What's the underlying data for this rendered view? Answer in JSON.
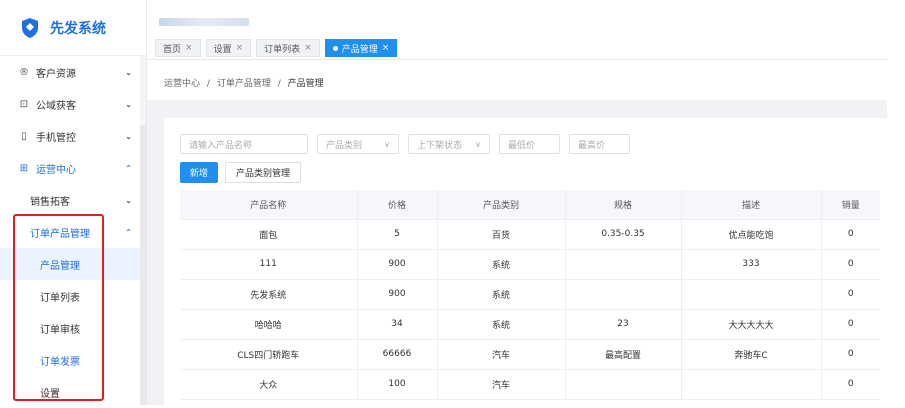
{
  "app": {
    "title": "先发系统"
  },
  "sidebar": {
    "items": [
      {
        "icon": "®",
        "label": "客户资源",
        "chev": "⌄"
      },
      {
        "icon": "⊡",
        "label": "公域获客",
        "chev": "⌄"
      },
      {
        "icon": "▯",
        "label": "手机管控",
        "chev": "⌄"
      },
      {
        "icon": "⊞",
        "label": "运营中心",
        "chev": "⌃"
      },
      {
        "label": "销售拓客",
        "chev": "⌄"
      },
      {
        "label": "订单产品管理",
        "chev": "⌃"
      },
      {
        "label": "产品管理"
      },
      {
        "label": "订单列表"
      },
      {
        "label": "订单审核"
      },
      {
        "label": "订单发票"
      },
      {
        "label": "设置"
      }
    ]
  },
  "tabs": [
    {
      "label": "首页"
    },
    {
      "label": "设置"
    },
    {
      "label": "订单列表"
    },
    {
      "label": "产品管理"
    }
  ],
  "tab_close": "×",
  "breadcrumb": {
    "a": "运营中心",
    "sep": "/",
    "b": "订单产品管理",
    "c": "产品管理"
  },
  "filters": {
    "name_placeholder": "请输入产品名称",
    "category": "产品类别",
    "status": "上下架状态",
    "min_price": "最低价",
    "max_price": "最高价",
    "arrow": "∨"
  },
  "buttons": {
    "add": "新增",
    "category_manage": "产品类别管理"
  },
  "table": {
    "headers": [
      "产品名称",
      "价格",
      "产品类别",
      "规格",
      "描述",
      "销量"
    ],
    "rows": [
      [
        "面包",
        "5",
        "百货",
        "0.35-0.35",
        "优点能吃饱",
        "0"
      ],
      [
        "111",
        "900",
        "系统",
        "",
        "333",
        "0"
      ],
      [
        "先发系统",
        "900",
        "系统",
        "",
        "",
        "0"
      ],
      [
        "哈哈哈",
        "34",
        "系统",
        "23",
        "大大大大大",
        "0"
      ],
      [
        "CLS四门轿跑车",
        "66666",
        "汽车",
        "最高配置",
        "奔驰车C",
        "0"
      ],
      [
        "大众",
        "100",
        "汽车",
        "",
        "",
        "0"
      ]
    ]
  },
  "colors": {
    "accent": "#1f8ff0",
    "brand": "#1f6fe0",
    "highlight_box": "#e02020"
  }
}
